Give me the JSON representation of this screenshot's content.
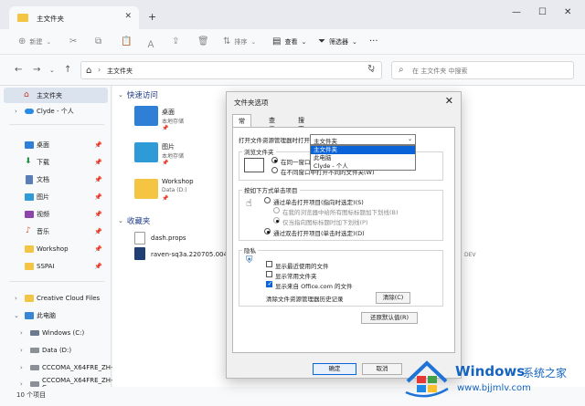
{
  "window": {
    "tab_title": "主文件夹",
    "status": "10 个项目"
  },
  "toolbar": {
    "new": "新建",
    "sort": "排序",
    "view": "查看",
    "filter": "筛选器"
  },
  "address": {
    "path": "主文件夹",
    "search_placeholder": "在 主文件夹 中搜索"
  },
  "sidebar": {
    "items": [
      {
        "label": "主文件夹",
        "selected": true
      },
      {
        "label": "Clyde - 个人"
      },
      {
        "label": "桌面",
        "pinned": true
      },
      {
        "label": "下载",
        "pinned": true
      },
      {
        "label": "文档",
        "pinned": true
      },
      {
        "label": "图片",
        "pinned": true
      },
      {
        "label": "视频",
        "pinned": true
      },
      {
        "label": "音乐",
        "pinned": true
      },
      {
        "label": "Workshop",
        "pinned": true
      },
      {
        "label": "SSPAI",
        "pinned": true
      },
      {
        "label": "Creative Cloud Files"
      },
      {
        "label": "此电脑"
      },
      {
        "label": "Windows (C:)"
      },
      {
        "label": "Data (D:)"
      },
      {
        "label": "CCCOMA_X64FRE_ZH-"
      },
      {
        "label": "CCCOMA_X64FRE_ZH-C"
      }
    ]
  },
  "main": {
    "quick_access": "快速访问",
    "favorites": "收藏夹",
    "tiles": [
      {
        "name": "桌面",
        "sub": "本地存储"
      },
      {
        "name": "图片",
        "sub": "本地存储"
      },
      {
        "name": "Workshop",
        "sub": "Data (D:)"
      }
    ],
    "files": [
      {
        "name": "dash.props"
      },
      {
        "name": "raven-sq3a.220705.004.x2-f"
      }
    ],
    "trailing": "DEV"
  },
  "dialog": {
    "title": "文件夹选项",
    "tabs": [
      "常规",
      "查看",
      "搜索"
    ],
    "open_label": "打开文件资源管理器时打开:",
    "open_value": "主文件夹",
    "open_options": [
      "主文件夹",
      "此电脑",
      "Clyde - 个人"
    ],
    "browse_group": "浏览文件夹",
    "browse_same": "在同一窗口中打开每个文件夹",
    "browse_new": "在不同窗口中打开不同的文件夹(W)",
    "click_group": "按如下方式单击项目",
    "single_click": "通过单击打开项目(指向时选定)(S)",
    "underline_browser": "在我的浏览器中给所有图标标题加下划线(B)",
    "underline_hover": "仅当指向图标标题时加下划线(P)",
    "double_click": "通过双击打开项目(单击时选定)(D)",
    "privacy_group": "隐私",
    "show_recent": "显示最近使用的文件",
    "show_frequent": "显示常用文件夹",
    "show_office": "显示来自 Office.com 的文件",
    "clear_history": "清除文件资源管理器历史记录",
    "clear_button": "清除(C)",
    "restore_button": "还原默认值(R)",
    "ok": "确定",
    "cancel": "取消"
  },
  "watermark": {
    "brand": "Windows",
    "cn": "系统之家",
    "url": "www.bjjmlv.com"
  }
}
